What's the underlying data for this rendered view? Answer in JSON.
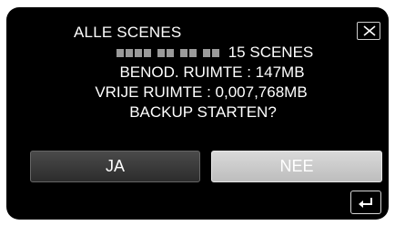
{
  "dialog": {
    "title": "ALLE SCENES",
    "scene_count": "15 SCENES",
    "required_space": "BENOD. RUIMTE : 147MB",
    "free_space": "VRIJE RUIMTE : 0,007,768MB",
    "question": "BACKUP STARTEN?"
  },
  "buttons": {
    "yes_label": "JA",
    "no_label": "NEE"
  },
  "icons": {
    "close": "close-icon",
    "back": "return-arrow-icon"
  },
  "colors": {
    "background": "#000000",
    "text": "#ffffff",
    "selected_button": "#c8c8c8",
    "unselected_button": "#3a3a3a"
  }
}
